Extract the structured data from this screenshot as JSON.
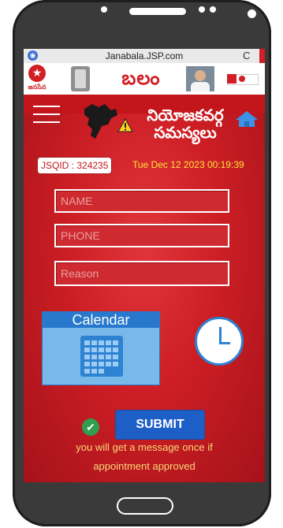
{
  "browser": {
    "url": "Janabala.JSP.com",
    "reload_glyph": "C"
  },
  "banner": {
    "party_name": "జనసేన",
    "title": "బలం"
  },
  "header": {
    "title_line1": "నియోజకవర్గ",
    "title_line2": "సమస్యలు"
  },
  "info": {
    "jsqid": "JSQID : 324235",
    "datetime": "Tue Dec 12 2023 00:19:39"
  },
  "form": {
    "name_placeholder": "NAME",
    "phone_placeholder": "PHONE",
    "reason_placeholder": "Reason",
    "calendar_label": "Calendar",
    "submit_label": "SUBMIT"
  },
  "footer": {
    "message_line1": "you will get a message once if",
    "message_line2": "appointment approved"
  },
  "colors": {
    "primary_red": "#c3161c",
    "accent_blue": "#2e82d2",
    "date_yellow": "#ffe23a",
    "message_yellow": "#f7d778",
    "check_green": "#2f9e4f"
  }
}
